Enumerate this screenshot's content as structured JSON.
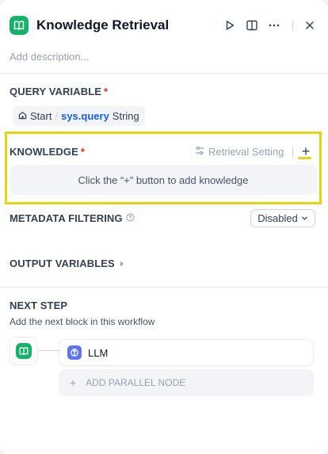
{
  "header": {
    "title": "Knowledge Retrieval",
    "description_placeholder": "Add description...",
    "icon": "book-icon",
    "icon_color": "#17b26a",
    "actions": [
      "play-icon",
      "split-view-icon",
      "more-icon",
      "close-icon"
    ]
  },
  "query_variable": {
    "label": "QUERY VARIABLE",
    "required_mark": "*",
    "chip": {
      "node": "Start",
      "separator": "/",
      "variable": "sys.query",
      "type": "String"
    }
  },
  "knowledge": {
    "label": "KNOWLEDGE",
    "required_mark": "*",
    "retrieval_setting": "Retrieval Setting",
    "add_symbol": "+",
    "empty_text": "Click the “+” button to add knowledge",
    "highlight_color": "#e6d312"
  },
  "metadata": {
    "label": "METADATA FILTERING",
    "selected": "Disabled"
  },
  "output": {
    "label": "OUTPUT VARIABLES"
  },
  "next_step": {
    "label": "NEXT STEP",
    "description": "Add the next block in this workflow",
    "node": "LLM",
    "node_icon_color": "#6172f3",
    "parallel": "ADD PARALLEL NODE",
    "parallel_symbol": "+"
  },
  "colors": {
    "accent": "#155eef",
    "required": "#d92d20"
  }
}
